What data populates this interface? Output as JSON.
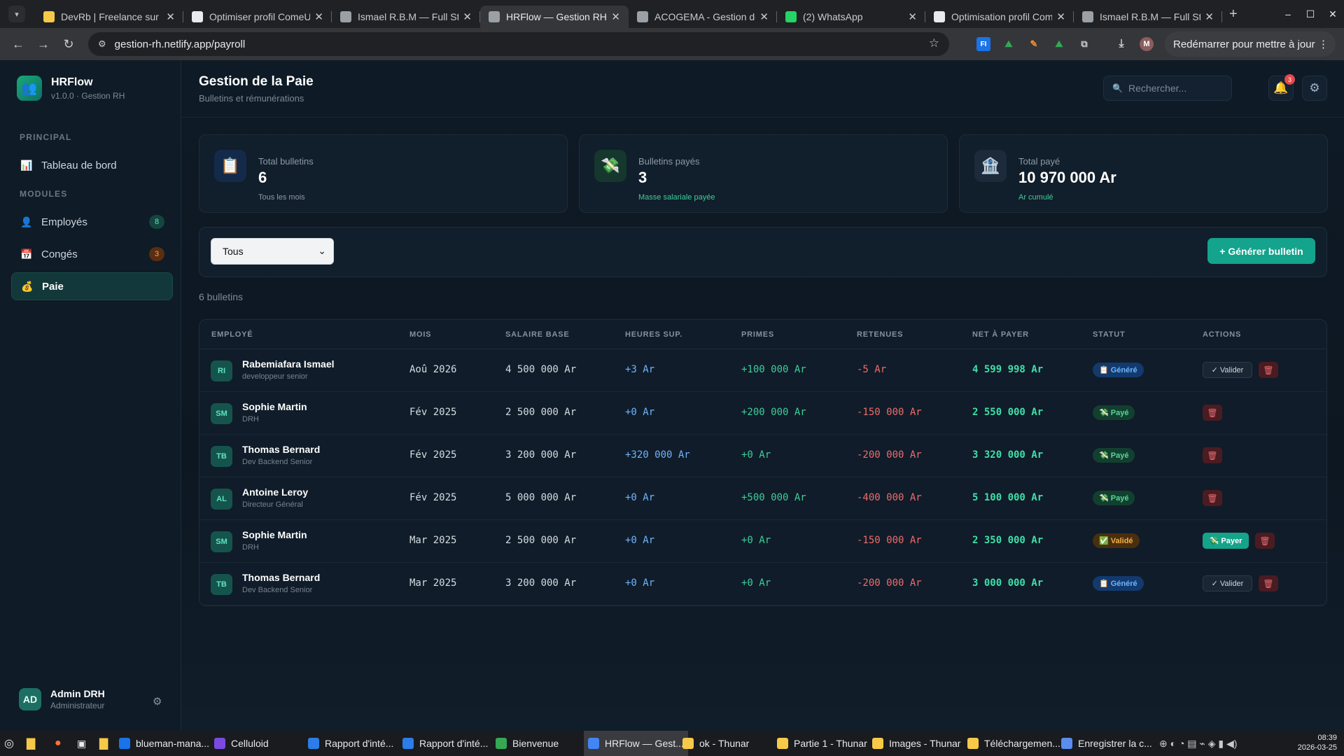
{
  "browser": {
    "tabs": [
      {
        "title": "DevRb | Freelance sur Co",
        "fav_color": "#f7c948"
      },
      {
        "title": "Optimiser profil ComeUp",
        "fav_color": "#e8eaed"
      },
      {
        "title": "Ismael R.B.M — Full Stac",
        "fav_color": "#9aa0a6"
      },
      {
        "title": "HRFlow — Gestion RH",
        "fav_color": "#9aa0a6",
        "active": true
      },
      {
        "title": "ACOGEMA - Gestion de l",
        "fav_color": "#9aa0a6"
      },
      {
        "title": "(2) WhatsApp",
        "fav_color": "#25d366"
      },
      {
        "title": "Optimisation profil Com",
        "fav_color": "#e8eaed"
      },
      {
        "title": "Ismael R.B.M — Full Stac",
        "fav_color": "#9aa0a6"
      }
    ],
    "url": "gestion-rh.netlify.app/payroll",
    "restart_label": "Redémarrer pour mettre à jour",
    "profile_initial": "M"
  },
  "sidebar": {
    "brand_name": "HRFlow",
    "brand_version": "v1.0.0 · Gestion RH",
    "section_principal": "PRINCIPAL",
    "section_modules": "MODULES",
    "items": [
      {
        "label": "Tableau de bord",
        "icon": "chart-icon"
      },
      {
        "label": "Employés",
        "icon": "person-icon",
        "badge": "8"
      },
      {
        "label": "Congés",
        "icon": "calendar-icon",
        "badge": "3"
      },
      {
        "label": "Paie",
        "icon": "money-bag-icon"
      }
    ],
    "user": {
      "initials": "AD",
      "name": "Admin DRH",
      "role": "Administrateur"
    }
  },
  "header": {
    "title": "Gestion de la Paie",
    "subtitle": "Bulletins et rémunérations",
    "search_placeholder": "Rechercher...",
    "notif_count": "3"
  },
  "stats": [
    {
      "label": "Total bulletins",
      "value": "6",
      "sub": "Tous les mois",
      "icon": "clipboard-icon",
      "sub_color": "#8e9aa7"
    },
    {
      "label": "Bulletins payés",
      "value": "3",
      "sub": "Masse salariale payée",
      "icon": "money-wings-icon",
      "sub_color": "#3ccf9a"
    },
    {
      "label": "Total payé",
      "value": "10 970 000 Ar",
      "sub": "Ar cumulé",
      "icon": "bank-icon",
      "sub_color": "#3ccf9a"
    }
  ],
  "filter": {
    "selected": "Tous",
    "generate_label": "+ Générer bulletin"
  },
  "count_label": "6 bulletins",
  "table": {
    "headers": [
      "EMPLOYÉ",
      "MOIS",
      "SALAIRE BASE",
      "HEURES SUP.",
      "PRIMES",
      "RETENUES",
      "NET À PAYER",
      "STATUT",
      "ACTIONS"
    ],
    "rows": [
      {
        "initials": "RI",
        "name": "Rabemiafara Ismael",
        "role": "developpeur senior",
        "month": "Aoû 2026",
        "base": "4 500 000 Ar",
        "overtime": "+3 Ar",
        "bonus": "+100 000 Ar",
        "deductions": "-5 Ar",
        "net": "4 599 998 Ar",
        "status": "📋 Généré",
        "status_kind": "gen",
        "actions": [
          "valider",
          "delete"
        ]
      },
      {
        "initials": "SM",
        "name": "Sophie Martin",
        "role": "DRH",
        "month": "Fév 2025",
        "base": "2 500 000 Ar",
        "overtime": "+0 Ar",
        "bonus": "+200 000 Ar",
        "deductions": "-150 000 Ar",
        "net": "2 550 000 Ar",
        "status": "💸 Payé",
        "status_kind": "paye",
        "actions": [
          "delete"
        ]
      },
      {
        "initials": "TB",
        "name": "Thomas Bernard",
        "role": "Dev Backend Senior",
        "month": "Fév 2025",
        "base": "3 200 000 Ar",
        "overtime": "+320 000 Ar",
        "bonus": "+0 Ar",
        "deductions": "-200 000 Ar",
        "net": "3 320 000 Ar",
        "status": "💸 Payé",
        "status_kind": "paye",
        "actions": [
          "delete"
        ]
      },
      {
        "initials": "AL",
        "name": "Antoine Leroy",
        "role": "Directeur Général",
        "month": "Fév 2025",
        "base": "5 000 000 Ar",
        "overtime": "+0 Ar",
        "bonus": "+500 000 Ar",
        "deductions": "-400 000 Ar",
        "net": "5 100 000 Ar",
        "status": "💸 Payé",
        "status_kind": "paye",
        "actions": [
          "delete"
        ]
      },
      {
        "initials": "SM",
        "name": "Sophie Martin",
        "role": "DRH",
        "month": "Mar 2025",
        "base": "2 500 000 Ar",
        "overtime": "+0 Ar",
        "bonus": "+0 Ar",
        "deductions": "-150 000 Ar",
        "net": "2 350 000 Ar",
        "status": "✅ Validé",
        "status_kind": "valide",
        "actions": [
          "payer",
          "delete"
        ]
      },
      {
        "initials": "TB",
        "name": "Thomas Bernard",
        "role": "Dev Backend Senior",
        "month": "Mar 2025",
        "base": "3 200 000 Ar",
        "overtime": "+0 Ar",
        "bonus": "+0 Ar",
        "deductions": "-200 000 Ar",
        "net": "3 000 000 Ar",
        "status": "📋 Généré",
        "status_kind": "gen",
        "actions": [
          "valider",
          "delete"
        ]
      }
    ],
    "valider_label": "✓ Valider",
    "payer_label": "💸 Payer",
    "delete_icon": "🗑"
  },
  "taskbar": {
    "items": [
      "blueman-mana...",
      "Celluloid",
      "Rapport d'inté...",
      "Rapport d'inté...",
      "Bienvenue",
      "HRFlow — Gest...",
      "ok - Thunar",
      "Partie 1 - Thunar",
      "Images - Thunar",
      "Téléchargemen...",
      "Enregistrer la c..."
    ],
    "active_index": 5,
    "time": "08:39",
    "date": "2026-03-25"
  }
}
